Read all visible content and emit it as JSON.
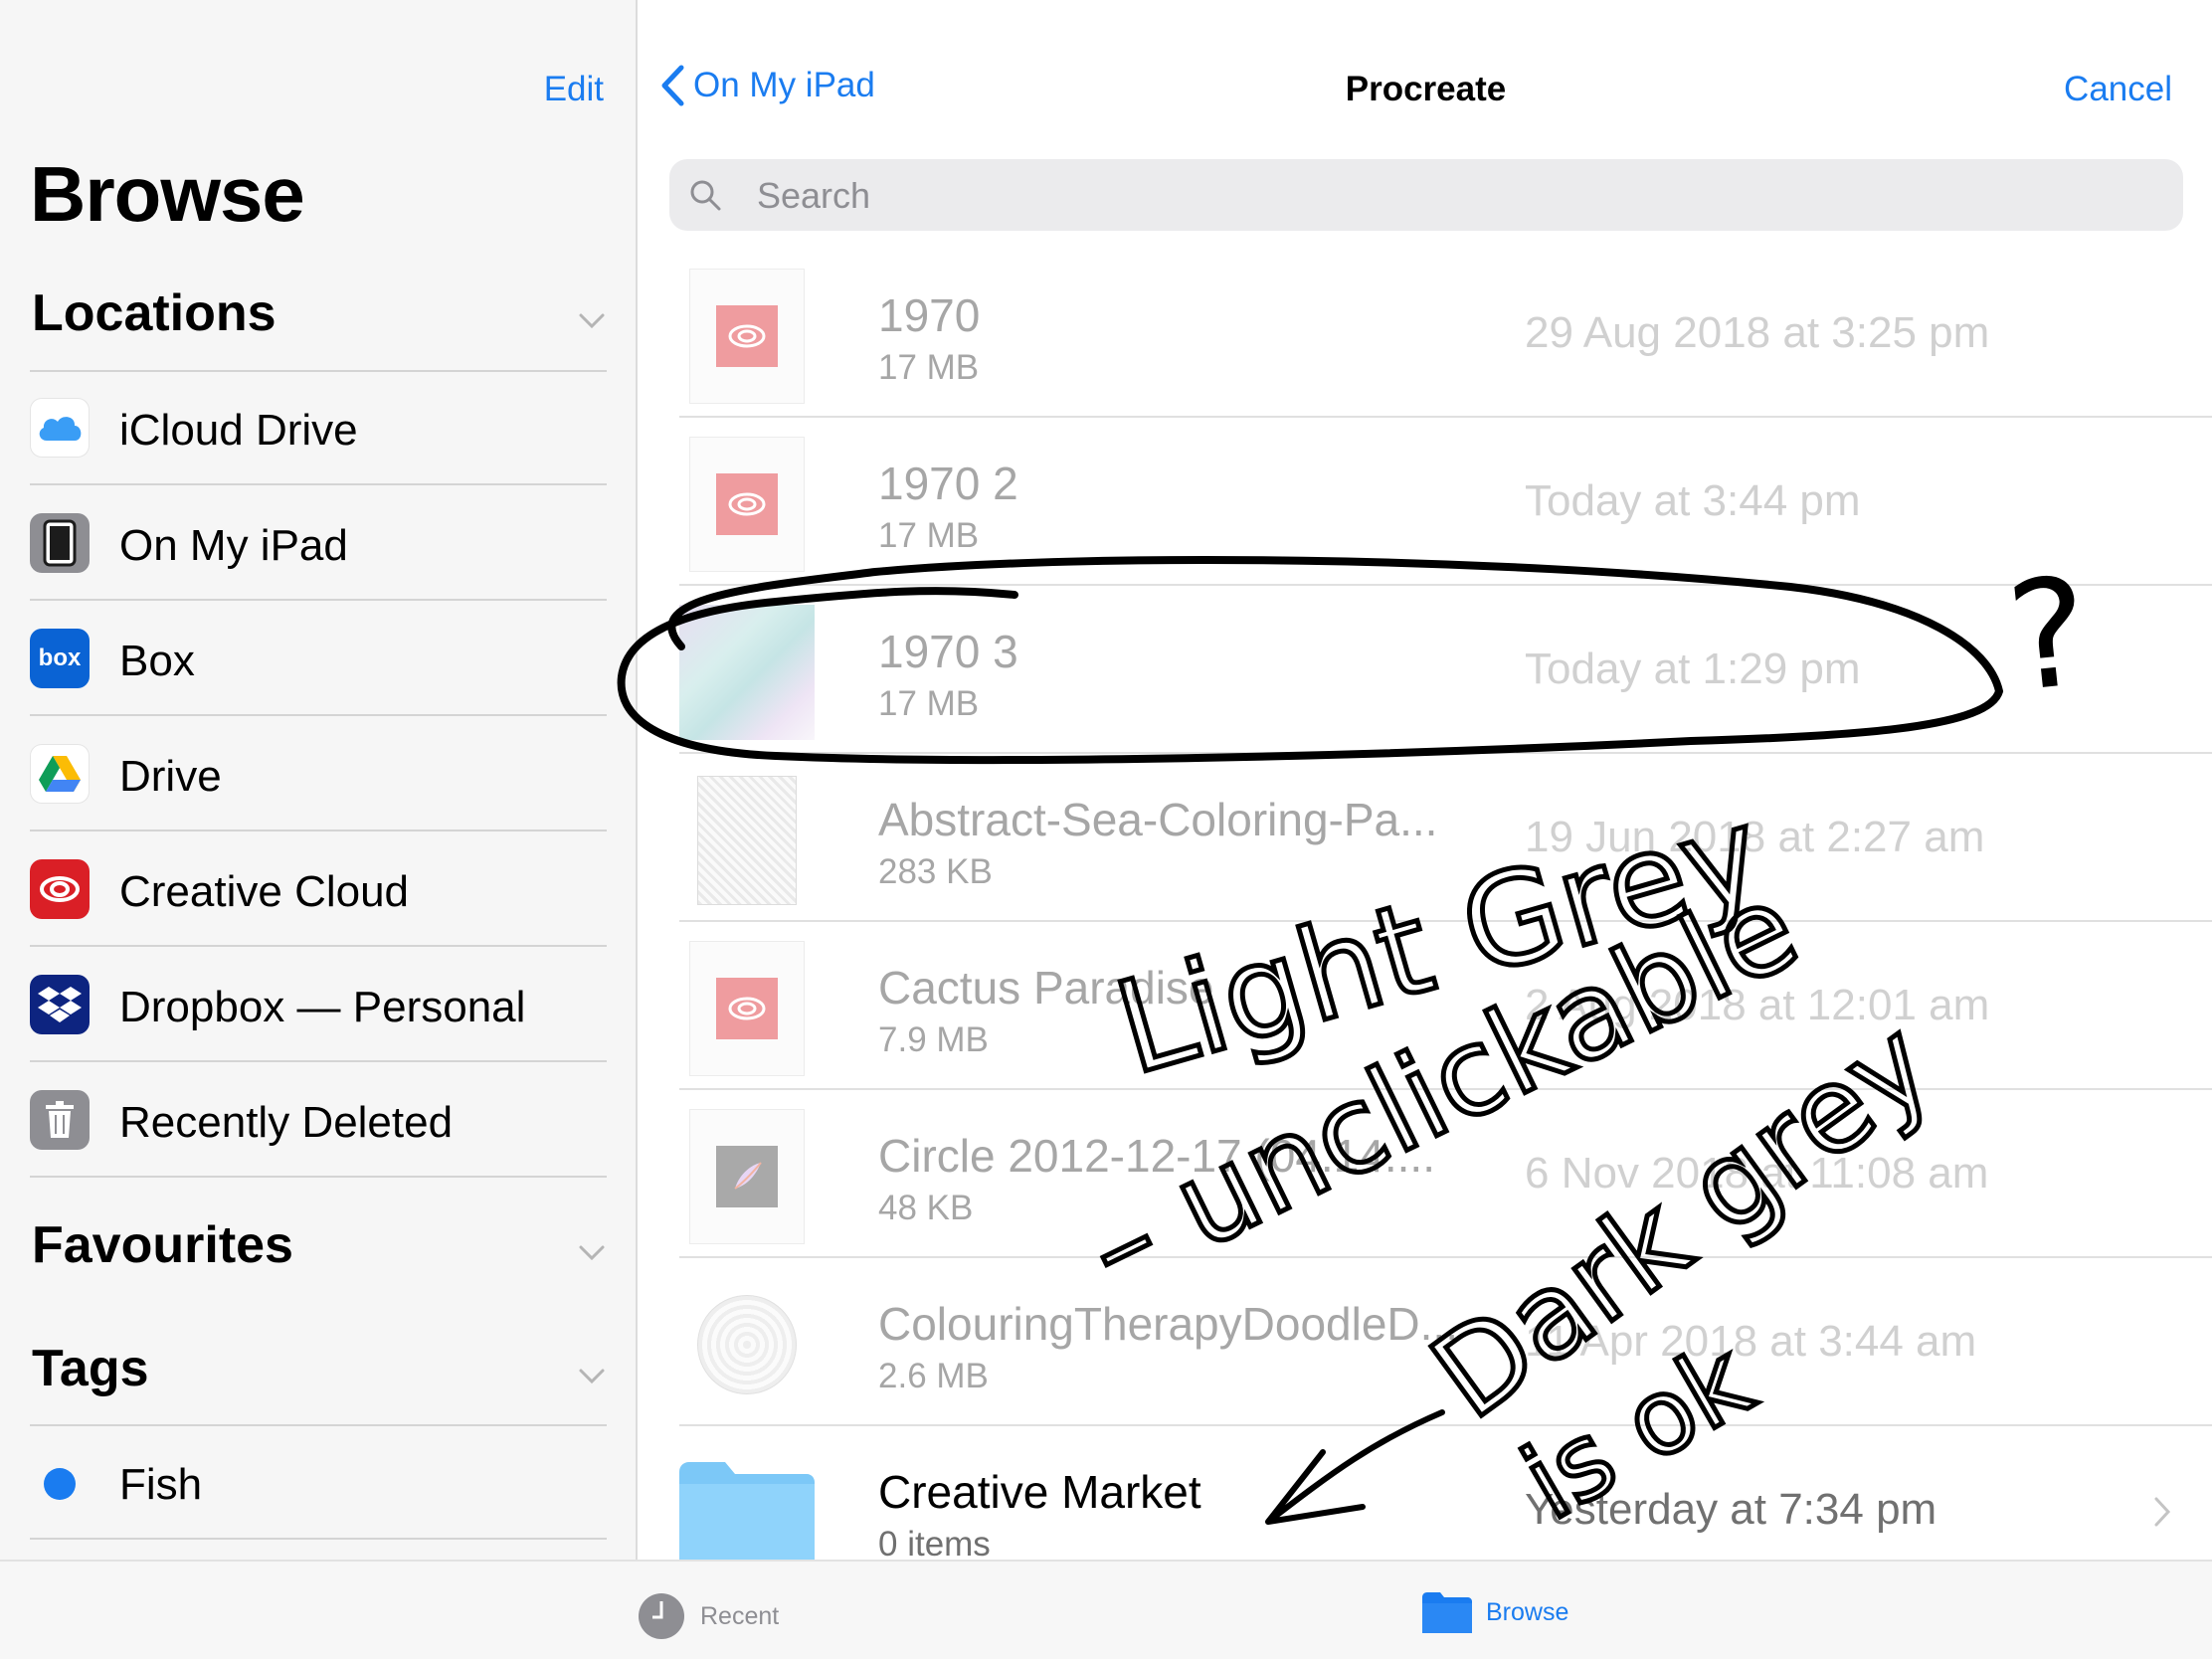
{
  "sidebar": {
    "edit_label": "Edit",
    "title": "Browse",
    "locations_header": "Locations",
    "locations": [
      {
        "label": "iCloud Drive",
        "icon": "icloud-icon"
      },
      {
        "label": "On My iPad",
        "icon": "ipad-icon"
      },
      {
        "label": "Box",
        "icon": "box-icon",
        "icon_text": "box"
      },
      {
        "label": "Drive",
        "icon": "google-drive-icon"
      },
      {
        "label": "Creative Cloud",
        "icon": "creative-cloud-icon"
      },
      {
        "label": "Dropbox — Personal",
        "icon": "dropbox-icon"
      },
      {
        "label": "Recently Deleted",
        "icon": "trash-icon"
      }
    ],
    "favourites_header": "Favourites",
    "tags_header": "Tags",
    "tags": [
      {
        "label": "Fish",
        "color": "#1a7cf0"
      }
    ]
  },
  "nav": {
    "back_label": "On My iPad",
    "title": "Procreate",
    "cancel_label": "Cancel"
  },
  "search": {
    "placeholder": "Search"
  },
  "files": [
    {
      "name": "1970",
      "size": "17 MB",
      "date": "29 Aug 2018 at 3:25 pm",
      "thumb": "creative-cloud-file-icon"
    },
    {
      "name": "1970 2",
      "size": "17 MB",
      "date": "Today at 3:44 pm",
      "thumb": "creative-cloud-file-icon"
    },
    {
      "name": "1970 3",
      "size": "17 MB",
      "date": "Today at 1:29 pm",
      "thumb": "artwork-preview-thumbnail"
    },
    {
      "name": "Abstract-Sea-Coloring-Pa...",
      "size": "283 KB",
      "date": "19 Jun 2018 at 2:27 am",
      "thumb": "coloring-page-thumbnail"
    },
    {
      "name": "Cactus Paradise",
      "size": "7.9 MB",
      "date": "2 Aug 2018 at 12:01 am",
      "thumb": "creative-cloud-file-icon"
    },
    {
      "name": "Circle 2012-12-17 (04.14....",
      "size": "48 KB",
      "date": "6 Nov 2018 at 11:08 am",
      "thumb": "procreate-file-icon"
    },
    {
      "name": "ColouringTherapyDoodleD...",
      "size": "2.6 MB",
      "date": "11 Apr 2018 at 3:44 am",
      "thumb": "doodle-thumbnail"
    },
    {
      "name": "Creative Market",
      "size": "0 items",
      "date": "Yesterday at 7:34 pm",
      "thumb": "folder-icon"
    }
  ],
  "tabbar": {
    "recent_label": "Recent",
    "browse_label": "Browse"
  },
  "annotations": {
    "question_mark": "?",
    "light_grey": "Light Grey",
    "unclickable": "– unclickable",
    "dark_grey": "Dark grey",
    "is_ok": "is ok"
  },
  "colors": {
    "accent": "#1a7cf0",
    "disabled_text": "#a6a6a6",
    "creative_cloud_red": "#ef9c9f"
  }
}
